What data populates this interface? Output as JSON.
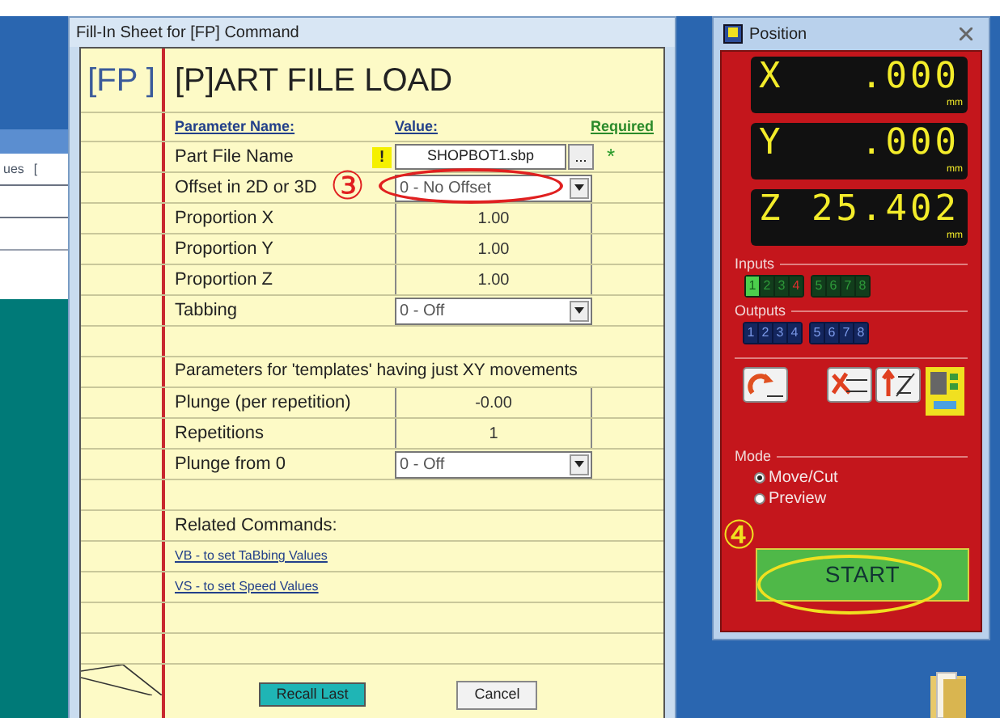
{
  "background_window": {
    "texts": [
      "ues",
      "["
    ]
  },
  "fill_in_sheet": {
    "title": "Fill-In Sheet for [FP] Command",
    "command_code": "[FP ]",
    "heading": "[P]ART FILE LOAD",
    "columns": {
      "name": "Parameter Name:",
      "value": "Value:",
      "required": "Required"
    },
    "parameters": [
      {
        "kind": "file",
        "name": "Part File Name",
        "warning": "!",
        "value": "SHOPBOT1.sbp",
        "browse": "...",
        "required_mark": "*"
      },
      {
        "kind": "select",
        "name": "Offset in 2D or 3D",
        "value": "0 - No Offset"
      },
      {
        "kind": "number",
        "name": "Proportion X",
        "value": "1.00"
      },
      {
        "kind": "number",
        "name": "Proportion Y",
        "value": "1.00"
      },
      {
        "kind": "number",
        "name": "Proportion Z",
        "value": "1.00"
      },
      {
        "kind": "select",
        "name": "Tabbing",
        "value": "0 - Off"
      }
    ],
    "section_note": "Parameters for 'templates' having just XY movements",
    "template_parameters": [
      {
        "kind": "number",
        "name": "Plunge (per repetition)",
        "value": "-0.00"
      },
      {
        "kind": "number",
        "name": "Repetitions",
        "value": "1"
      },
      {
        "kind": "select",
        "name": "Plunge from 0",
        "value": "0 - Off"
      }
    ],
    "related_heading": "Related Commands:",
    "related_links": [
      "VB - to set TaBbing Values",
      "VS - to set Speed Values"
    ],
    "buttons": [
      {
        "label": "Recall Last",
        "kind": "primary"
      },
      {
        "label": "Cancel",
        "kind": "normal"
      }
    ]
  },
  "position_window": {
    "title": "Position",
    "axes": [
      {
        "axis": "X",
        "value": ".000",
        "unit": "mm"
      },
      {
        "axis": "Y",
        "value": ".000",
        "unit": "mm"
      },
      {
        "axis": "Z",
        "value": "25.402",
        "unit": "mm"
      }
    ],
    "inputs_label": "Inputs",
    "inputs": [
      {
        "label": "1",
        "on": true,
        "color": "#4ccf4c"
      },
      {
        "label": "2",
        "on": false,
        "color": "#2f9a3a"
      },
      {
        "label": "3",
        "on": false,
        "color": "#2f9a3a"
      },
      {
        "label": "4",
        "on": false,
        "color": "#e03030"
      },
      {
        "label": "5",
        "on": false,
        "color": "#2f9a3a"
      },
      {
        "label": "6",
        "on": false,
        "color": "#2f9a3a"
      },
      {
        "label": "7",
        "on": false,
        "color": "#2f9a3a"
      },
      {
        "label": "8",
        "on": false,
        "color": "#2f9a3a"
      }
    ],
    "outputs_label": "Outputs",
    "outputs": [
      "1",
      "2",
      "3",
      "4",
      "5",
      "6",
      "7",
      "8"
    ],
    "mode_label": "Mode",
    "modes": [
      {
        "label": "Move/Cut",
        "selected": true
      },
      {
        "label": "Preview",
        "selected": false
      }
    ],
    "start_button": "START"
  },
  "annotations": [
    {
      "label": "③",
      "color": "#e02020"
    },
    {
      "label": "④",
      "color": "#f0e020"
    }
  ]
}
